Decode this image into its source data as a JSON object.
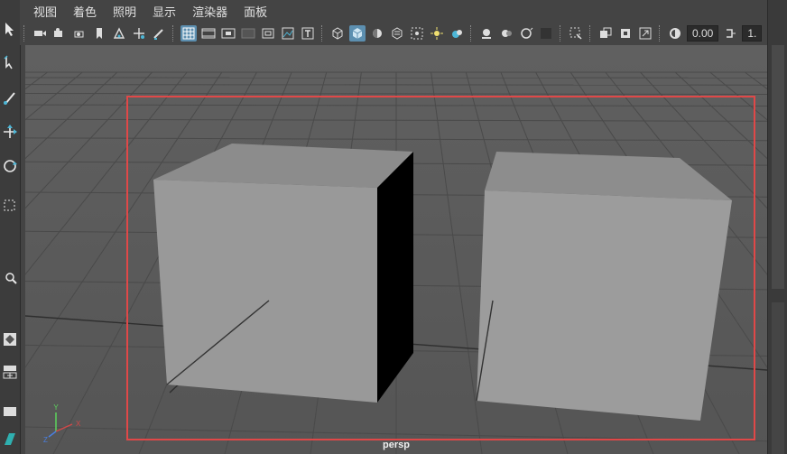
{
  "menubar": {
    "items": [
      "视图",
      "着色",
      "照明",
      "显示",
      "渲染器",
      "面板"
    ]
  },
  "toolbar": {
    "exposure_value": "0.00",
    "gamma_value": "1."
  },
  "viewport": {
    "camera_label": "persp",
    "background": "#5a5a5a",
    "gate_color": "#e04848"
  },
  "axis": {
    "x": "X",
    "y": "Y",
    "z": "Z"
  },
  "icons": {
    "left_toolbox": [
      "select-tool-icon",
      "lasso-tool-icon",
      "paint-select-icon",
      "move-tool-icon",
      "rotate-tool-icon",
      "scale-tool-icon",
      "universal-manipulator-icon",
      "show-manipulator-icon",
      "layout-single-icon",
      "layout-four-icon",
      "layout-outliner-icon"
    ],
    "panel_toolbar": [
      "select-camera-icon",
      "camera-attributes-icon",
      "bookmark-icon",
      "image-plane-icon",
      "2d-pan-zoom-icon",
      "grease-pencil-icon",
      "grid-icon",
      "film-gate-icon",
      "resolution-gate-icon",
      "gate-mask-icon",
      "field-chart-icon",
      "safe-action-icon",
      "safe-title-icon",
      "wireframe-icon",
      "smooth-shade-icon",
      "default-material-icon",
      "textured-icon",
      "use-all-lights-icon",
      "shadows-icon",
      "ambient-occlusion-icon",
      "motion-blur-icon",
      "anti-aliasing-icon",
      "depth-of-field-icon",
      "isolate-select-icon",
      "xray-icon",
      "xray-joints-icon",
      "xray-components-icon",
      "backface-culling-icon",
      "exposure-icon",
      "gamma-icon"
    ]
  }
}
